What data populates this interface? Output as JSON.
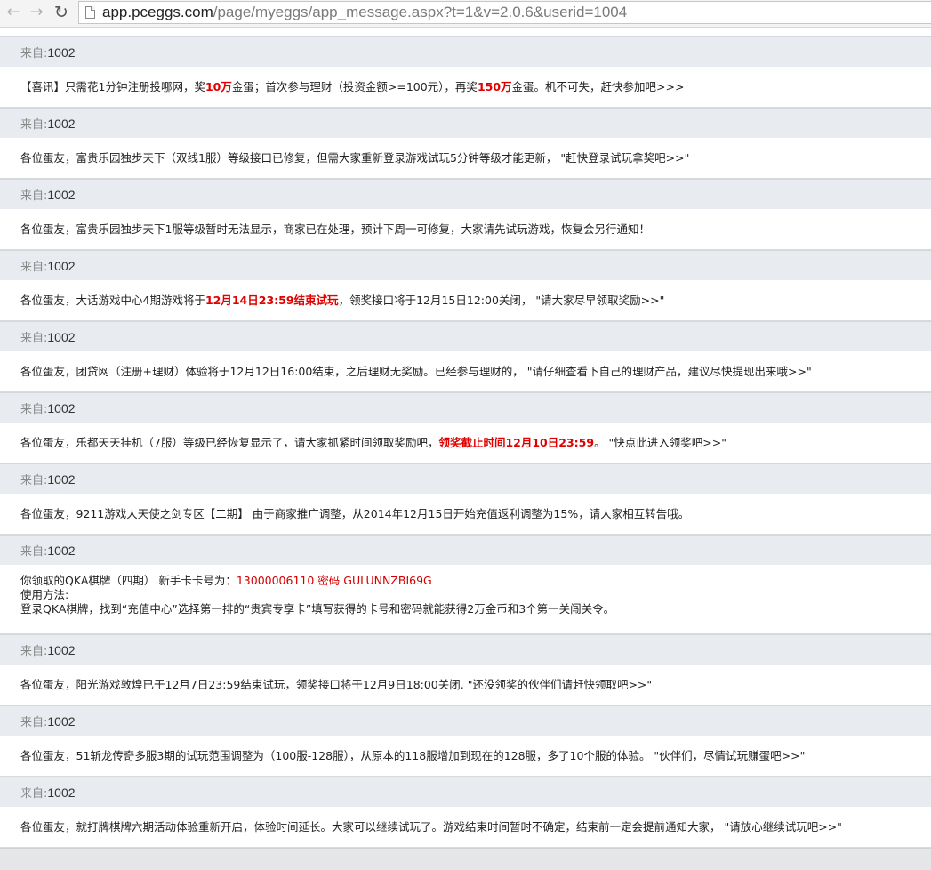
{
  "browser": {
    "url_host": "app.pceggs.com",
    "url_path": "/page/myeggs/app_message.aspx?t=1&v=2.0.6&userid=1004"
  },
  "label_from": "来自:",
  "messages": [
    {
      "sender": "1002",
      "parts": [
        {
          "t": "【喜讯】只需花1分钟注册投哪网，奖"
        },
        {
          "t": "10万",
          "s": "em"
        },
        {
          "t": "金蛋；首次参与理财（投资金额>=100元），再奖"
        },
        {
          "t": "150万",
          "s": "em"
        },
        {
          "t": "金蛋。机不可失，赶快参加吧>>>"
        }
      ]
    },
    {
      "sender": "1002",
      "parts": [
        {
          "t": "各位蛋友，富贵乐园独步天下（双线1服）等级接口已修复，但需大家重新登录游戏试玩5分钟等级才能更新， \"赶快登录试玩拿奖吧>>\""
        }
      ]
    },
    {
      "sender": "1002",
      "parts": [
        {
          "t": "各位蛋友，富贵乐园独步天下1服等级暂时无法显示，商家已在处理，预计下周一可修复，大家请先试玩游戏，恢复会另行通知！"
        }
      ]
    },
    {
      "sender": "1002",
      "parts": [
        {
          "t": "各位蛋友，大话游戏中心4期游戏将于"
        },
        {
          "t": "12月14日23:59结束试玩",
          "s": "em"
        },
        {
          "t": "，领奖接口将于12月15日12:00关闭， \"请大家尽早领取奖励>>\""
        }
      ]
    },
    {
      "sender": "1002",
      "parts": [
        {
          "t": "各位蛋友，团贷网（注册+理财）体验将于12月12日16:00结束，之后理财无奖励。已经参与理财的， \"请仔细查看下自己的理财产品，建议尽快提现出来哦>>\""
        }
      ]
    },
    {
      "sender": "1002",
      "parts": [
        {
          "t": "各位蛋友，乐都天天挂机（7服）等级已经恢复显示了，请大家抓紧时间领取奖励吧，"
        },
        {
          "t": "领奖截止时间12月10日23:59",
          "s": "em"
        },
        {
          "t": "。 \"快点此进入领奖吧>>\""
        }
      ]
    },
    {
      "sender": "1002",
      "parts": [
        {
          "t": "各位蛋友，9211游戏大天使之剑专区【二期】 由于商家推广调整，从2014年12月15日开始充值返利调整为15%，请大家相互转告哦。"
        }
      ]
    },
    {
      "sender": "1002",
      "tall": true,
      "lines": [
        [
          {
            "t": "你领取的QKA棋牌（四期） 新手卡卡号为："
          },
          {
            "t": "13000006110 密码 GULUNNZBI69G",
            "s": "red"
          }
        ],
        [
          {
            "t": "使用方法:"
          }
        ],
        [
          {
            "t": "登录QKA棋牌，找到“充值中心”选择第一排的“贵宾专享卡”填写获得的卡号和密码就能获得2万金币和3个第一关闯关令。"
          }
        ]
      ]
    },
    {
      "sender": "1002",
      "parts": [
        {
          "t": "各位蛋友，阳光游戏敦煌已于12月7日23:59结束试玩，领奖接口将于12月9日18:00关闭. \"还没领奖的伙伴们请赶快领取吧>>\""
        }
      ]
    },
    {
      "sender": "1002",
      "parts": [
        {
          "t": "各位蛋友，51斩龙传奇多服3期的试玩范围调整为（100服-128服），从原本的118服增加到现在的128服，多了10个服的体验。 \"伙伴们，尽情试玩赚蛋吧>>\""
        }
      ]
    },
    {
      "sender": "1002",
      "parts": [
        {
          "t": "各位蛋友，就打牌棋牌六期活动体验重新开启，体验时间延长。大家可以继续试玩了。游戏结束时间暂时不确定，结束前一定会提前通知大家， \"请放心继续试玩吧>>\""
        }
      ]
    }
  ]
}
